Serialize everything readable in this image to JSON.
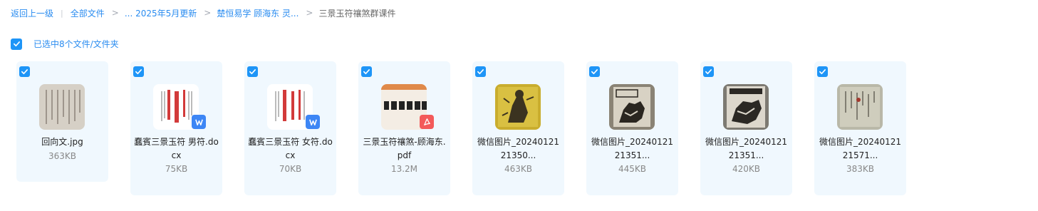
{
  "breadcrumb": {
    "back": "返回上一级",
    "items": [
      "全部文件",
      "... 2025年5月更新",
      "楚恒易学 顾海东 灵...",
      "三景玉符禳煞群课件"
    ]
  },
  "selection": {
    "text": "已选中8个文件/文件夹",
    "all_checked": true
  },
  "colors": {
    "accent": "#1e95f7",
    "card_bg": "#f0f8fe",
    "word_badge": "#3d86f5",
    "pdf_badge": "#f35a5a"
  },
  "files": [
    {
      "name": "回向文.jpg",
      "size": "363KB",
      "type": "image",
      "icon": "image-thumbnail-scroll"
    },
    {
      "name": "蠢賓三景玉符 男符.docx",
      "size": "75KB",
      "type": "docx",
      "icon": "word-icon"
    },
    {
      "name": "蠢賓三景玉符 女符.docx",
      "size": "70KB",
      "type": "docx",
      "icon": "word-icon"
    },
    {
      "name": "三景玉符禳煞-顾海东.pdf",
      "size": "13.2M",
      "type": "pdf",
      "icon": "pdf-icon"
    },
    {
      "name": "微信图片_2024012121350...",
      "size": "463KB",
      "type": "image",
      "icon": "image-thumbnail-yellow-talisman"
    },
    {
      "name": "微信图片_2024012121351...",
      "size": "445KB",
      "type": "image",
      "icon": "image-thumbnail-talisman"
    },
    {
      "name": "微信图片_2024012121351...",
      "size": "420KB",
      "type": "image",
      "icon": "image-thumbnail-talisman"
    },
    {
      "name": "微信图片_2024012121571...",
      "size": "383KB",
      "type": "image",
      "icon": "image-thumbnail-scroll"
    }
  ]
}
